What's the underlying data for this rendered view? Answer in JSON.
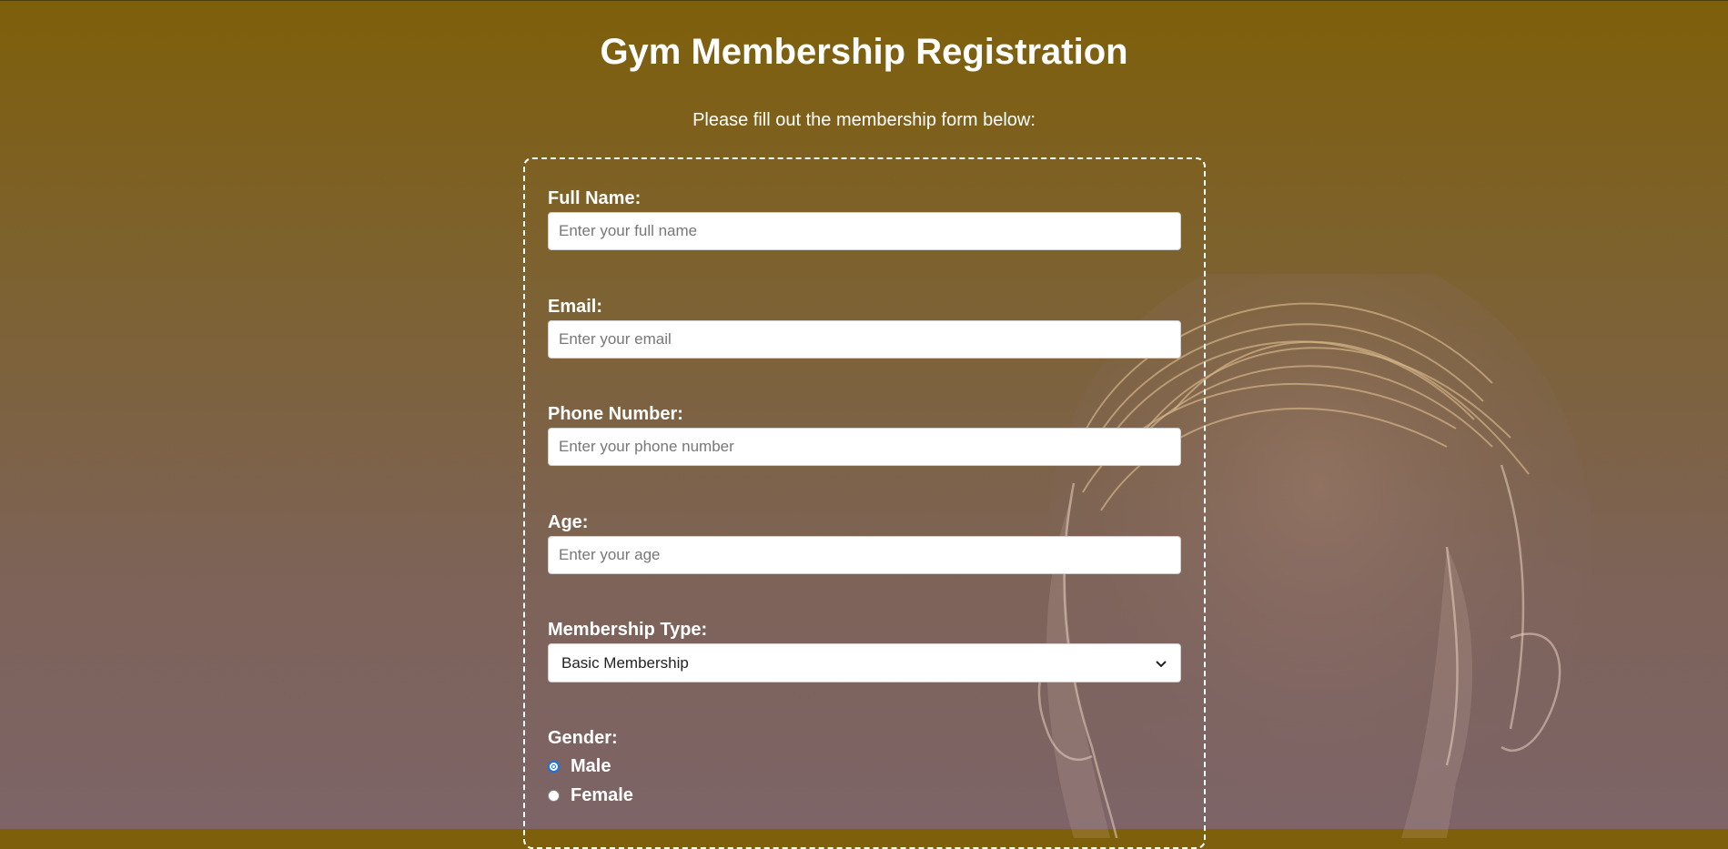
{
  "page": {
    "title": "Gym Membership Registration",
    "subtitle": "Please fill out the membership form below:"
  },
  "form": {
    "full_name": {
      "label": "Full Name:",
      "placeholder": "Enter your full name",
      "value": ""
    },
    "email": {
      "label": "Email:",
      "placeholder": "Enter your email",
      "value": ""
    },
    "phone": {
      "label": "Phone Number:",
      "placeholder": "Enter your phone number",
      "value": ""
    },
    "age": {
      "label": "Age:",
      "placeholder": "Enter your age",
      "value": ""
    },
    "membership_type": {
      "label": "Membership Type:",
      "selected": "Basic Membership"
    },
    "gender": {
      "label": "Gender:",
      "options": [
        {
          "label": "Male",
          "checked": true
        },
        {
          "label": "Female",
          "checked": false
        }
      ]
    }
  },
  "colors": {
    "gradient_top": "#7e5f0a",
    "gradient_bottom": "#7d6467",
    "text": "#ffffff",
    "radio_accent": "#1a73e8"
  },
  "icons": {
    "select_arrow": "chevron-down-icon",
    "background": "man-portrait-illustration"
  }
}
